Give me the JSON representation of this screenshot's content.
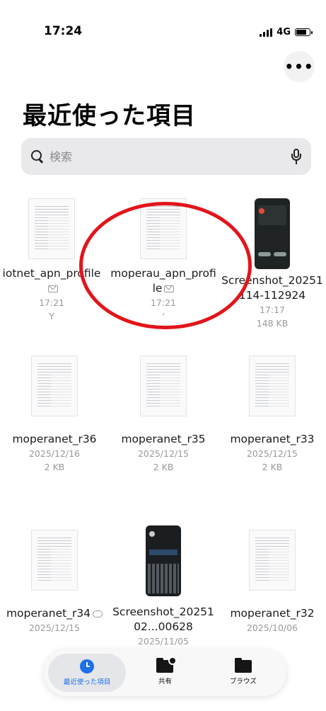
{
  "status_bar": {
    "time": "17:24",
    "network": "4G",
    "battery_level": 0.8
  },
  "header": {
    "more_button": "•••",
    "title": "最近使った項目"
  },
  "search": {
    "placeholder": "検索"
  },
  "files": [
    {
      "name": "iotnet_apn_profile",
      "date": "17:21",
      "size": "Y",
      "thumb": "doc",
      "badge": "mail-icon"
    },
    {
      "name": "moperau_apn_profile",
      "date": "17:21",
      "size": "'",
      "thumb": "doc",
      "badge": "mail-icon"
    },
    {
      "name": "Screenshot_20251114-112924",
      "date": "17:17",
      "size": "148 KB",
      "thumb": "phone",
      "badge": ""
    },
    {
      "name": "moperanet_r36",
      "date": "2025/12/16",
      "size": "2 KB",
      "thumb": "doc",
      "badge": ""
    },
    {
      "name": "moperanet_r35",
      "date": "2025/12/15",
      "size": "2 KB",
      "thumb": "doc",
      "badge": ""
    },
    {
      "name": "moperanet_r33",
      "date": "2025/12/15",
      "size": "2 KB",
      "thumb": "doc",
      "badge": ""
    },
    {
      "name": "moperanet_r34",
      "date": "2025/12/15",
      "size": "",
      "thumb": "doc",
      "badge": "cloud-icon"
    },
    {
      "name": "Screenshot_2025102...00628",
      "date": "2025/11/05",
      "size": "",
      "thumb": "kbd",
      "badge": ""
    },
    {
      "name": "moperanet_r32",
      "date": "2025/10/06",
      "size": "",
      "thumb": "doc",
      "badge": ""
    }
  ],
  "tab_bar": {
    "recent": "最近使った項目",
    "shared": "共有",
    "browse": "ブラウズ"
  },
  "colors": {
    "accent": "#1e6fe8",
    "annotation": "#e3141a"
  }
}
